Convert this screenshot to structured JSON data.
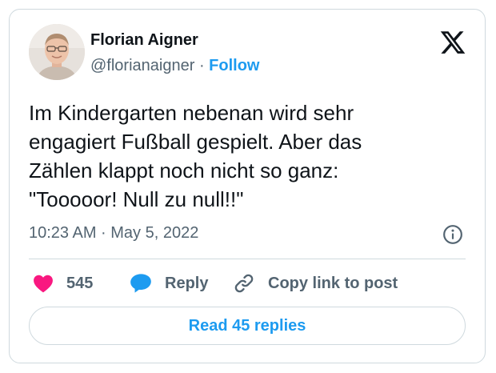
{
  "author": {
    "name": "Florian Aigner",
    "handle": "@florianaigner",
    "separator": "·",
    "follow_label": "Follow"
  },
  "tweet": {
    "lines": [
      "Im Kindergarten nebenan wird sehr",
      "engagiert Fußball gespielt. Aber das",
      "Zählen klappt noch nicht so ganz:",
      "\"Tooooor! Null zu null!!\""
    ],
    "timestamp": "10:23 AM · May 5, 2022"
  },
  "actions": {
    "like_count": "545",
    "reply_label": "Reply",
    "copy_link_label": "Copy link to post"
  },
  "read_replies_label": "Read 45 replies",
  "icons": {
    "logo": "x-logo-icon",
    "info": "info-icon",
    "like": "heart-icon",
    "reply": "speech-bubble-icon",
    "copy": "link-icon"
  },
  "colors": {
    "accent": "#1d9bf0",
    "like": "#f91880",
    "text": "#0f1419",
    "secondary": "#536471",
    "border": "#cfd9de"
  }
}
